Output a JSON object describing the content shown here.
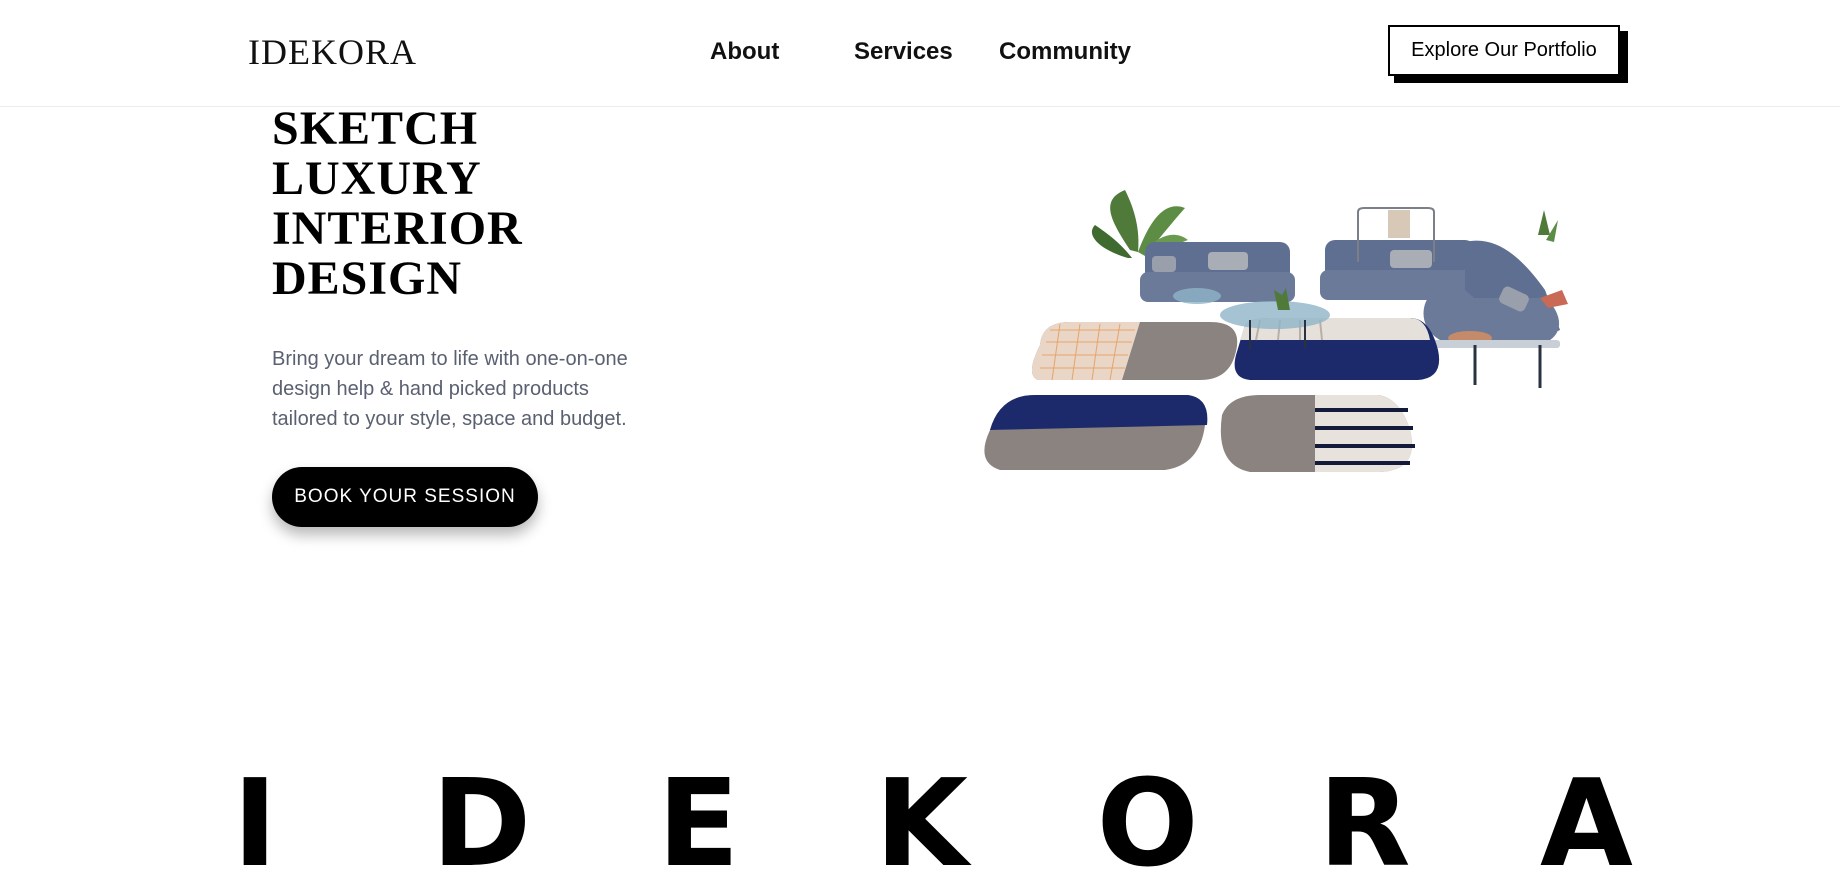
{
  "header": {
    "logo": "IDEKORA",
    "nav": [
      "About",
      "Services",
      "Community"
    ],
    "portfolio_button": "Explore Our Portfolio"
  },
  "hero": {
    "title_lines": [
      "SKETCH",
      "LUXURY",
      "INTERIOR",
      "DESIGN"
    ],
    "subtitle": "Bring your dream to life with one-on-one design help & hand picked products tailored to your style, space and budget.",
    "cta": "BOOK YOUR SESSION",
    "image": "living-room-furniture-set-illustration"
  },
  "brand_strip": {
    "letters": [
      "I",
      "D",
      "E",
      "K",
      "O",
      "R",
      "A"
    ]
  },
  "colors": {
    "background": "#ffffff",
    "text": "#000000",
    "subtitle": "#5a6070",
    "sofa": "#6b7a99",
    "rug_navy": "#1c2a6b",
    "rug_grey": "#8a8380"
  }
}
